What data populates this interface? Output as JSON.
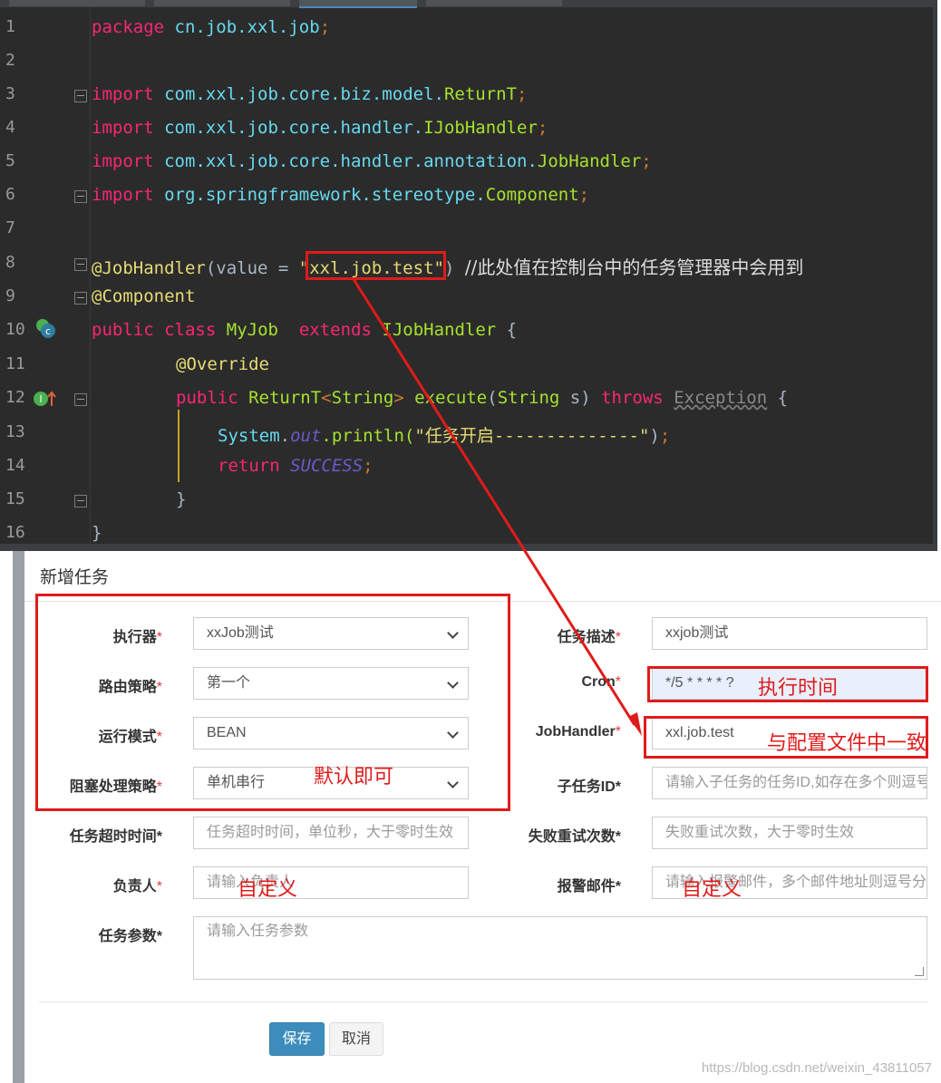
{
  "editor": {
    "lines": [
      {
        "num": "1"
      },
      {
        "num": "2"
      },
      {
        "num": "3"
      },
      {
        "num": "4"
      },
      {
        "num": "5"
      },
      {
        "num": "6"
      },
      {
        "num": "7"
      },
      {
        "num": "8"
      },
      {
        "num": "9"
      },
      {
        "num": "10"
      },
      {
        "num": "11"
      },
      {
        "num": "12"
      },
      {
        "num": "13"
      },
      {
        "num": "14"
      },
      {
        "num": "15"
      },
      {
        "num": "16"
      }
    ],
    "l1": {
      "kw": "package",
      "pkg": "cn.job.xxl.job",
      "semi": ";"
    },
    "l3": {
      "kw": "import",
      "pkg": "com.xxl.job.core.biz.model.",
      "cls": "ReturnT",
      "semi": ";"
    },
    "l4": {
      "kw": "import",
      "pkg": "com.xxl.job.core.handler.",
      "cls": "IJobHandler",
      "semi": ";"
    },
    "l5": {
      "kw": "import",
      "pkg": "com.xxl.job.core.handler.annotation.",
      "cls": "JobHandler",
      "semi": ";"
    },
    "l6": {
      "kw": "import",
      "pkg": "org.springframework.stereotype.",
      "cls": "Component",
      "semi": ";"
    },
    "l8": {
      "ann": "@JobHandler",
      "open": "(value = ",
      "str": "\"xxl.job.test\"",
      "close": ") ",
      "comment": "//此处值在控制台中的任务管理器中会用到"
    },
    "l9": {
      "ann": "@Component"
    },
    "l10": {
      "kw1": "public",
      "kw2": "class",
      "cls1": "MyJob",
      "kw3": "extends",
      "cls2": "IJobHandler",
      "brace": "{"
    },
    "l11": {
      "ann": "@Override"
    },
    "l12": {
      "kw1": "public",
      "cls1": "ReturnT",
      "gen_open": "<",
      "cls2": "String",
      "gen_close": ">",
      "method": "execute",
      "p_open": "(",
      "cls3": "String",
      "param": " s) ",
      "kw2": "throws",
      "exc": "Exception",
      "brace": " {"
    },
    "l13": {
      "cls": "System",
      "dot": ".",
      "field": "out",
      "call": ".println(",
      "str": "\"任务开启--------------\"",
      "end": ")",
      "semi": ";"
    },
    "l14": {
      "kw": "return",
      "const": "SUCCESS",
      "semi": ";"
    },
    "l15": {
      "brace": "}"
    },
    "l16": {
      "brace": "}"
    }
  },
  "form": {
    "title": "新增任务",
    "req_mark": "*",
    "executor": {
      "label": "执行器",
      "value": "xxJob测试"
    },
    "desc": {
      "label": "任务描述",
      "value": "xxjob测试"
    },
    "route": {
      "label": "路由策略",
      "value": "第一个"
    },
    "cron": {
      "label": "Cron",
      "value": "*/5 * * * * ?"
    },
    "mode": {
      "label": "运行模式",
      "value": "BEAN"
    },
    "handler": {
      "label": "JobHandler",
      "value": "xxl.job.test"
    },
    "block": {
      "label": "阻塞处理策略",
      "value": "单机串行"
    },
    "child": {
      "label": "子任务ID",
      "placeholder": "请输入子任务的任务ID,如存在多个则逗号分隔"
    },
    "timeout": {
      "label": "任务超时时间",
      "placeholder": "任务超时时间，单位秒，大于零时生效"
    },
    "retry": {
      "label": "失败重试次数",
      "placeholder": "失败重试次数，大于零时生效"
    },
    "owner": {
      "label": "负责人",
      "placeholder": "请输入负责人"
    },
    "email": {
      "label": "报警邮件",
      "placeholder": "请输入报警邮件，多个邮件地址则逗号分隔"
    },
    "param": {
      "label": "任务参数",
      "placeholder": "请输入任务参数"
    },
    "save": "保存",
    "cancel": "取消"
  },
  "annotations": {
    "cron_note": "执行时间",
    "handler_note": "与配置文件中一致",
    "default_note": "默认即可",
    "owner_note": "自定义",
    "email_note": "自定义",
    "color": "#e01b1b"
  },
  "watermark": "https://blog.csdn.net/weixin_43811057"
}
